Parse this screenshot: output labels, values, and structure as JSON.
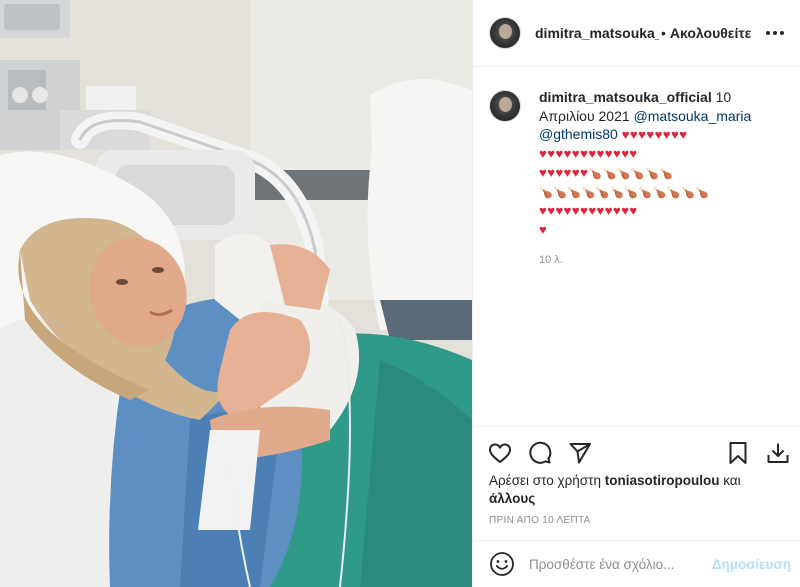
{
  "post": {
    "username_header": "dimitra_matsouka_official",
    "header_separator": "•",
    "follow_label": "Ακολουθείτε",
    "more_icon": "more-horizontal-icon"
  },
  "caption": {
    "username": "dimitra_matsouka_official",
    "date_text": "10 Απριλίου 2021",
    "mention_1": "@matsouka_maria",
    "mention_2": "@gthemis80",
    "hearts_line_1": "♥♥♥♥♥♥♥♥",
    "hearts_line_2": "♥♥♥♥♥♥♥♥♥♥♥♥",
    "hearts_line_3": "♥♥♥♥♥♥",
    "drums_line_3": "🍗🍗🍗🍗🍗🍗",
    "drums_line_4": "🍗🍗🍗🍗🍗🍗🍗🍗🍗🍗🍗🍗",
    "hearts_line_5": "♥♥♥♥♥♥♥♥♥♥♥♥",
    "hearts_line_6": "♥",
    "time_ago": "10 λ."
  },
  "actions": {
    "like_icon": "heart-icon",
    "comment_icon": "comment-icon",
    "share_icon": "share-icon",
    "save_icon": "bookmark-icon",
    "download_icon": "download-icon"
  },
  "likes": {
    "prefix": "Αρέσει στο χρήστη ",
    "user": "toniasotiropoulou",
    "conj": " και",
    "others": "άλλους"
  },
  "timestamp": "ΠΡΙΝ ΑΠΟ 10 ΛΕΠΤΑ",
  "comment": {
    "emoji_icon": "smiley-icon",
    "placeholder": "Προσθέστε ένα σχόλιο...",
    "post_label": "Δημοσίευση"
  },
  "colors": {
    "mention": "#00376b",
    "post_button_disabled": "#b2dffc",
    "meta_text": "#8e8e8e",
    "heart": "#e0243b"
  }
}
